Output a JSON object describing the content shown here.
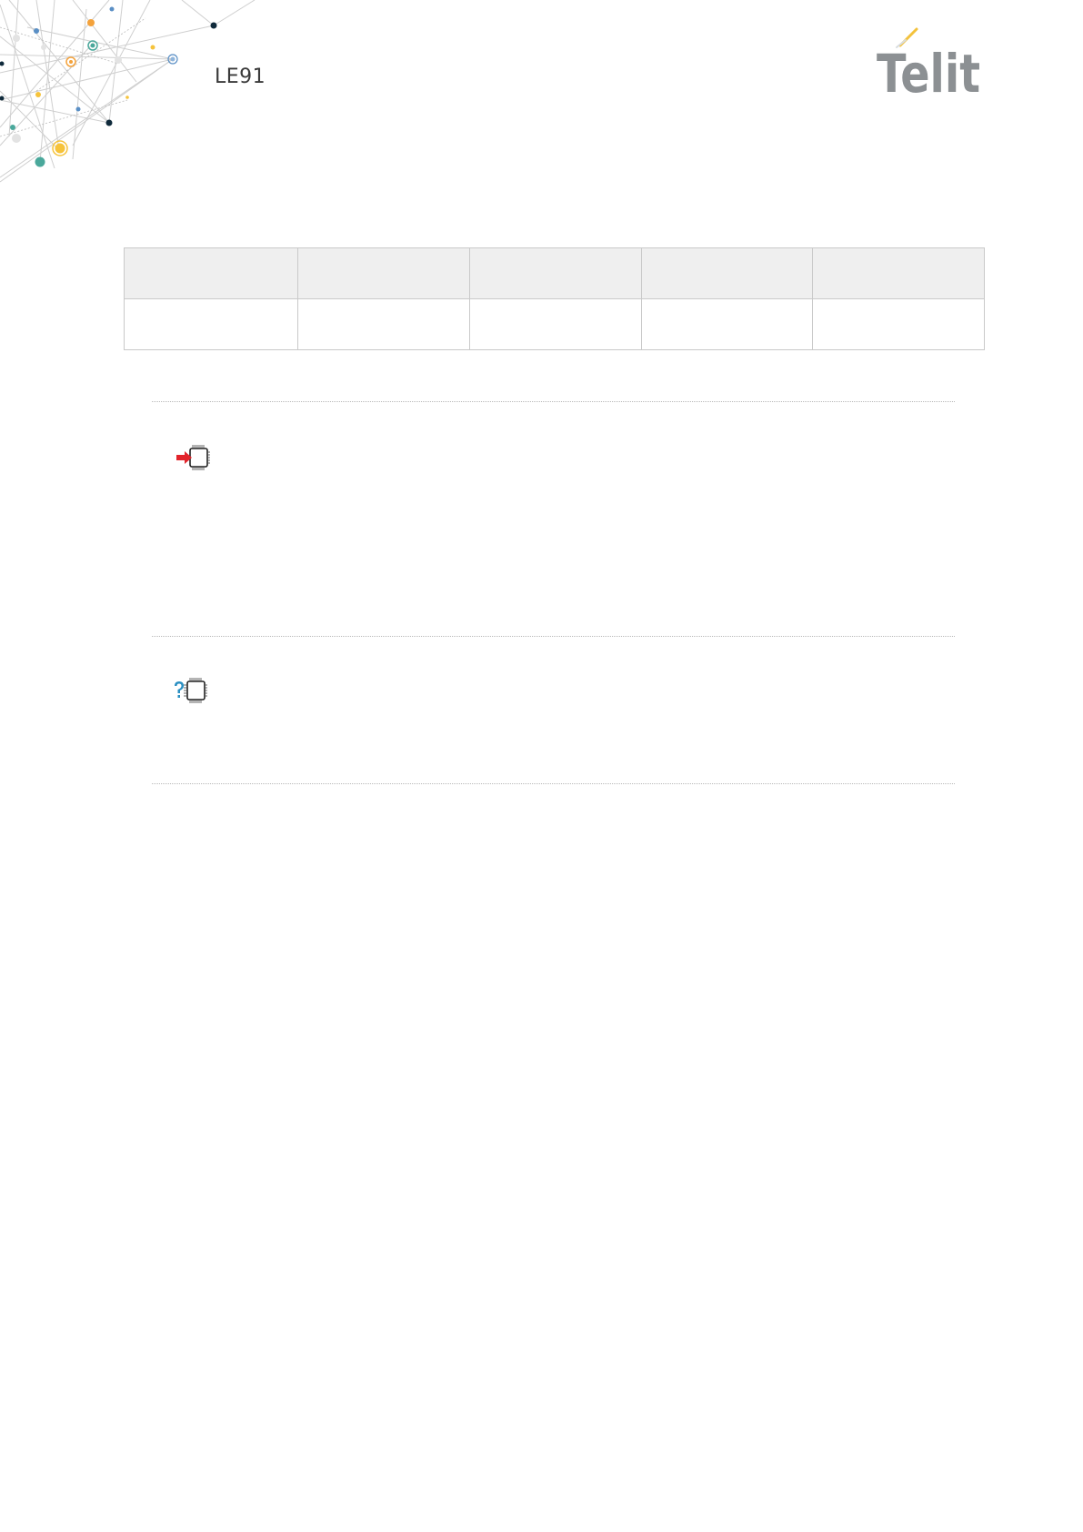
{
  "header": {
    "doc_title": "LE91",
    "logo_text": "Telit",
    "logo_color": "#8c9093",
    "logo_accent_color": "#f3c23c"
  },
  "table": {
    "rows": [
      {
        "cells": [
          "",
          "",
          "",
          "",
          ""
        ]
      },
      {
        "cells": [
          "",
          "",
          "",
          "",
          ""
        ]
      }
    ],
    "header_row_background": "#efefef",
    "border_color": "#c9c9c9"
  },
  "sections": [
    {
      "icon": "set-command-icon"
    },
    {
      "icon": "read-command-icon"
    }
  ],
  "decoration": {
    "name": "network-pattern",
    "palette": [
      "#f4a23b",
      "#4aa89b",
      "#5a8fc5",
      "#f6c33b",
      "#0f2a3b",
      "#d8d8d8"
    ]
  }
}
